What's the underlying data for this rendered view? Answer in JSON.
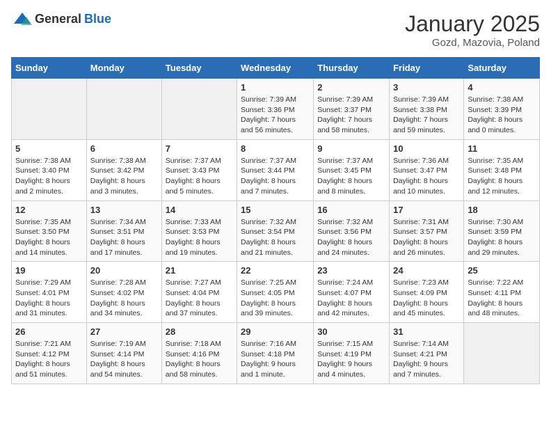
{
  "logo": {
    "general": "General",
    "blue": "Blue"
  },
  "title": "January 2025",
  "subtitle": "Gozd, Mazovia, Poland",
  "days_header": [
    "Sunday",
    "Monday",
    "Tuesday",
    "Wednesday",
    "Thursday",
    "Friday",
    "Saturday"
  ],
  "weeks": [
    [
      {
        "day": "",
        "sunrise": "",
        "sunset": "",
        "daylight": ""
      },
      {
        "day": "",
        "sunrise": "",
        "sunset": "",
        "daylight": ""
      },
      {
        "day": "",
        "sunrise": "",
        "sunset": "",
        "daylight": ""
      },
      {
        "day": "1",
        "sunrise": "Sunrise: 7:39 AM",
        "sunset": "Sunset: 3:36 PM",
        "daylight": "Daylight: 7 hours and 56 minutes."
      },
      {
        "day": "2",
        "sunrise": "Sunrise: 7:39 AM",
        "sunset": "Sunset: 3:37 PM",
        "daylight": "Daylight: 7 hours and 58 minutes."
      },
      {
        "day": "3",
        "sunrise": "Sunrise: 7:39 AM",
        "sunset": "Sunset: 3:38 PM",
        "daylight": "Daylight: 7 hours and 59 minutes."
      },
      {
        "day": "4",
        "sunrise": "Sunrise: 7:38 AM",
        "sunset": "Sunset: 3:39 PM",
        "daylight": "Daylight: 8 hours and 0 minutes."
      }
    ],
    [
      {
        "day": "5",
        "sunrise": "Sunrise: 7:38 AM",
        "sunset": "Sunset: 3:40 PM",
        "daylight": "Daylight: 8 hours and 2 minutes."
      },
      {
        "day": "6",
        "sunrise": "Sunrise: 7:38 AM",
        "sunset": "Sunset: 3:42 PM",
        "daylight": "Daylight: 8 hours and 3 minutes."
      },
      {
        "day": "7",
        "sunrise": "Sunrise: 7:37 AM",
        "sunset": "Sunset: 3:43 PM",
        "daylight": "Daylight: 8 hours and 5 minutes."
      },
      {
        "day": "8",
        "sunrise": "Sunrise: 7:37 AM",
        "sunset": "Sunset: 3:44 PM",
        "daylight": "Daylight: 8 hours and 7 minutes."
      },
      {
        "day": "9",
        "sunrise": "Sunrise: 7:37 AM",
        "sunset": "Sunset: 3:45 PM",
        "daylight": "Daylight: 8 hours and 8 minutes."
      },
      {
        "day": "10",
        "sunrise": "Sunrise: 7:36 AM",
        "sunset": "Sunset: 3:47 PM",
        "daylight": "Daylight: 8 hours and 10 minutes."
      },
      {
        "day": "11",
        "sunrise": "Sunrise: 7:35 AM",
        "sunset": "Sunset: 3:48 PM",
        "daylight": "Daylight: 8 hours and 12 minutes."
      }
    ],
    [
      {
        "day": "12",
        "sunrise": "Sunrise: 7:35 AM",
        "sunset": "Sunset: 3:50 PM",
        "daylight": "Daylight: 8 hours and 14 minutes."
      },
      {
        "day": "13",
        "sunrise": "Sunrise: 7:34 AM",
        "sunset": "Sunset: 3:51 PM",
        "daylight": "Daylight: 8 hours and 17 minutes."
      },
      {
        "day": "14",
        "sunrise": "Sunrise: 7:33 AM",
        "sunset": "Sunset: 3:53 PM",
        "daylight": "Daylight: 8 hours and 19 minutes."
      },
      {
        "day": "15",
        "sunrise": "Sunrise: 7:32 AM",
        "sunset": "Sunset: 3:54 PM",
        "daylight": "Daylight: 8 hours and 21 minutes."
      },
      {
        "day": "16",
        "sunrise": "Sunrise: 7:32 AM",
        "sunset": "Sunset: 3:56 PM",
        "daylight": "Daylight: 8 hours and 24 minutes."
      },
      {
        "day": "17",
        "sunrise": "Sunrise: 7:31 AM",
        "sunset": "Sunset: 3:57 PM",
        "daylight": "Daylight: 8 hours and 26 minutes."
      },
      {
        "day": "18",
        "sunrise": "Sunrise: 7:30 AM",
        "sunset": "Sunset: 3:59 PM",
        "daylight": "Daylight: 8 hours and 29 minutes."
      }
    ],
    [
      {
        "day": "19",
        "sunrise": "Sunrise: 7:29 AM",
        "sunset": "Sunset: 4:01 PM",
        "daylight": "Daylight: 8 hours and 31 minutes."
      },
      {
        "day": "20",
        "sunrise": "Sunrise: 7:28 AM",
        "sunset": "Sunset: 4:02 PM",
        "daylight": "Daylight: 8 hours and 34 minutes."
      },
      {
        "day": "21",
        "sunrise": "Sunrise: 7:27 AM",
        "sunset": "Sunset: 4:04 PM",
        "daylight": "Daylight: 8 hours and 37 minutes."
      },
      {
        "day": "22",
        "sunrise": "Sunrise: 7:25 AM",
        "sunset": "Sunset: 4:05 PM",
        "daylight": "Daylight: 8 hours and 39 minutes."
      },
      {
        "day": "23",
        "sunrise": "Sunrise: 7:24 AM",
        "sunset": "Sunset: 4:07 PM",
        "daylight": "Daylight: 8 hours and 42 minutes."
      },
      {
        "day": "24",
        "sunrise": "Sunrise: 7:23 AM",
        "sunset": "Sunset: 4:09 PM",
        "daylight": "Daylight: 8 hours and 45 minutes."
      },
      {
        "day": "25",
        "sunrise": "Sunrise: 7:22 AM",
        "sunset": "Sunset: 4:11 PM",
        "daylight": "Daylight: 8 hours and 48 minutes."
      }
    ],
    [
      {
        "day": "26",
        "sunrise": "Sunrise: 7:21 AM",
        "sunset": "Sunset: 4:12 PM",
        "daylight": "Daylight: 8 hours and 51 minutes."
      },
      {
        "day": "27",
        "sunrise": "Sunrise: 7:19 AM",
        "sunset": "Sunset: 4:14 PM",
        "daylight": "Daylight: 8 hours and 54 minutes."
      },
      {
        "day": "28",
        "sunrise": "Sunrise: 7:18 AM",
        "sunset": "Sunset: 4:16 PM",
        "daylight": "Daylight: 8 hours and 58 minutes."
      },
      {
        "day": "29",
        "sunrise": "Sunrise: 7:16 AM",
        "sunset": "Sunset: 4:18 PM",
        "daylight": "Daylight: 9 hours and 1 minute."
      },
      {
        "day": "30",
        "sunrise": "Sunrise: 7:15 AM",
        "sunset": "Sunset: 4:19 PM",
        "daylight": "Daylight: 9 hours and 4 minutes."
      },
      {
        "day": "31",
        "sunrise": "Sunrise: 7:14 AM",
        "sunset": "Sunset: 4:21 PM",
        "daylight": "Daylight: 9 hours and 7 minutes."
      },
      {
        "day": "",
        "sunrise": "",
        "sunset": "",
        "daylight": ""
      }
    ]
  ]
}
